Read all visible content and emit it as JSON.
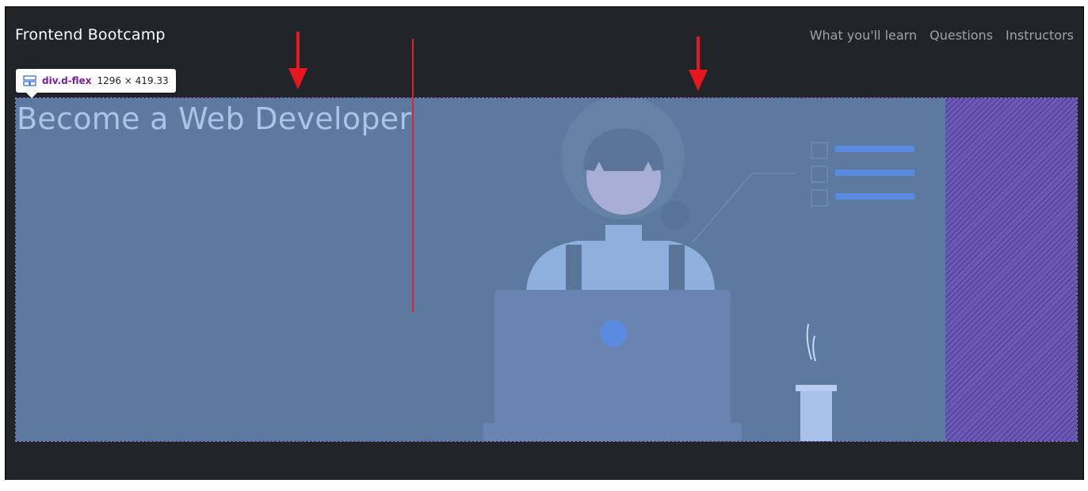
{
  "header": {
    "brand": "Frontend Bootcamp",
    "nav": [
      "What you'll learn",
      "Questions",
      "Instructors"
    ]
  },
  "devtools_tooltip": {
    "selector": "div.d-flex",
    "size": "1296 × 419.33"
  },
  "hero": {
    "title": "Become a Web Developer"
  },
  "colors": {
    "page_bg": "#212529",
    "hero_bg": "#5c7a9f",
    "hero_title": "#a8c4e6",
    "highlight_hatch": "#6b59b4",
    "annotation_red": "#e0202a"
  },
  "icons": [
    "flex-layout-icon",
    "arrow-down-icon"
  ]
}
